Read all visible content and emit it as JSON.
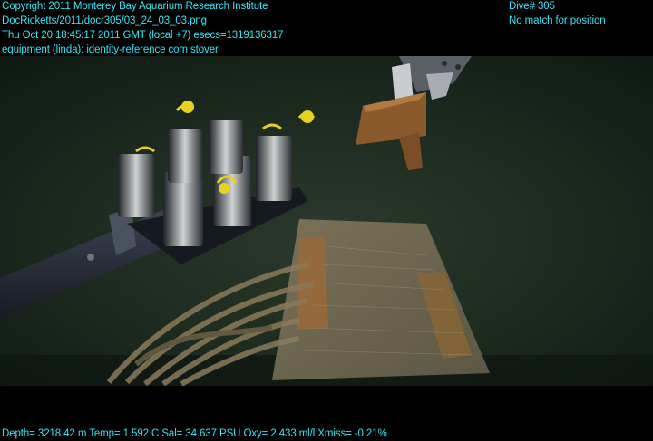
{
  "overlay": {
    "copyright": "Copyright 2011 Monterey Bay Aquarium Research Institute",
    "file_path": "DocRicketts/2011/docr305/03_24_03_03.png",
    "timestamp": "Thu Oct 20 18:45:17 2011 GMT (local +7)  esecs=1319136317",
    "equipment": "equipment (linda): identity-reference com stover",
    "dive": "Dive# 305",
    "position": "No match for position",
    "telemetry": "Depth= 3218.42 m  Temp= 1.592 C  Sal= 34.637 PSU  Oxy= 2.433 ml/l  Xmiss= -0.21%"
  },
  "colors": {
    "overlay_text": "#33e6f2",
    "water": "#1c2a1f",
    "wood": "#8a6a3c",
    "sediment": "#6f6a55",
    "handle_yellow": "#e8d21a"
  },
  "scene_objects": [
    "push-core-rack",
    "manipulator-arm",
    "robotic-claw",
    "wooden-block",
    "wooden-pallet",
    "rope-coil"
  ]
}
